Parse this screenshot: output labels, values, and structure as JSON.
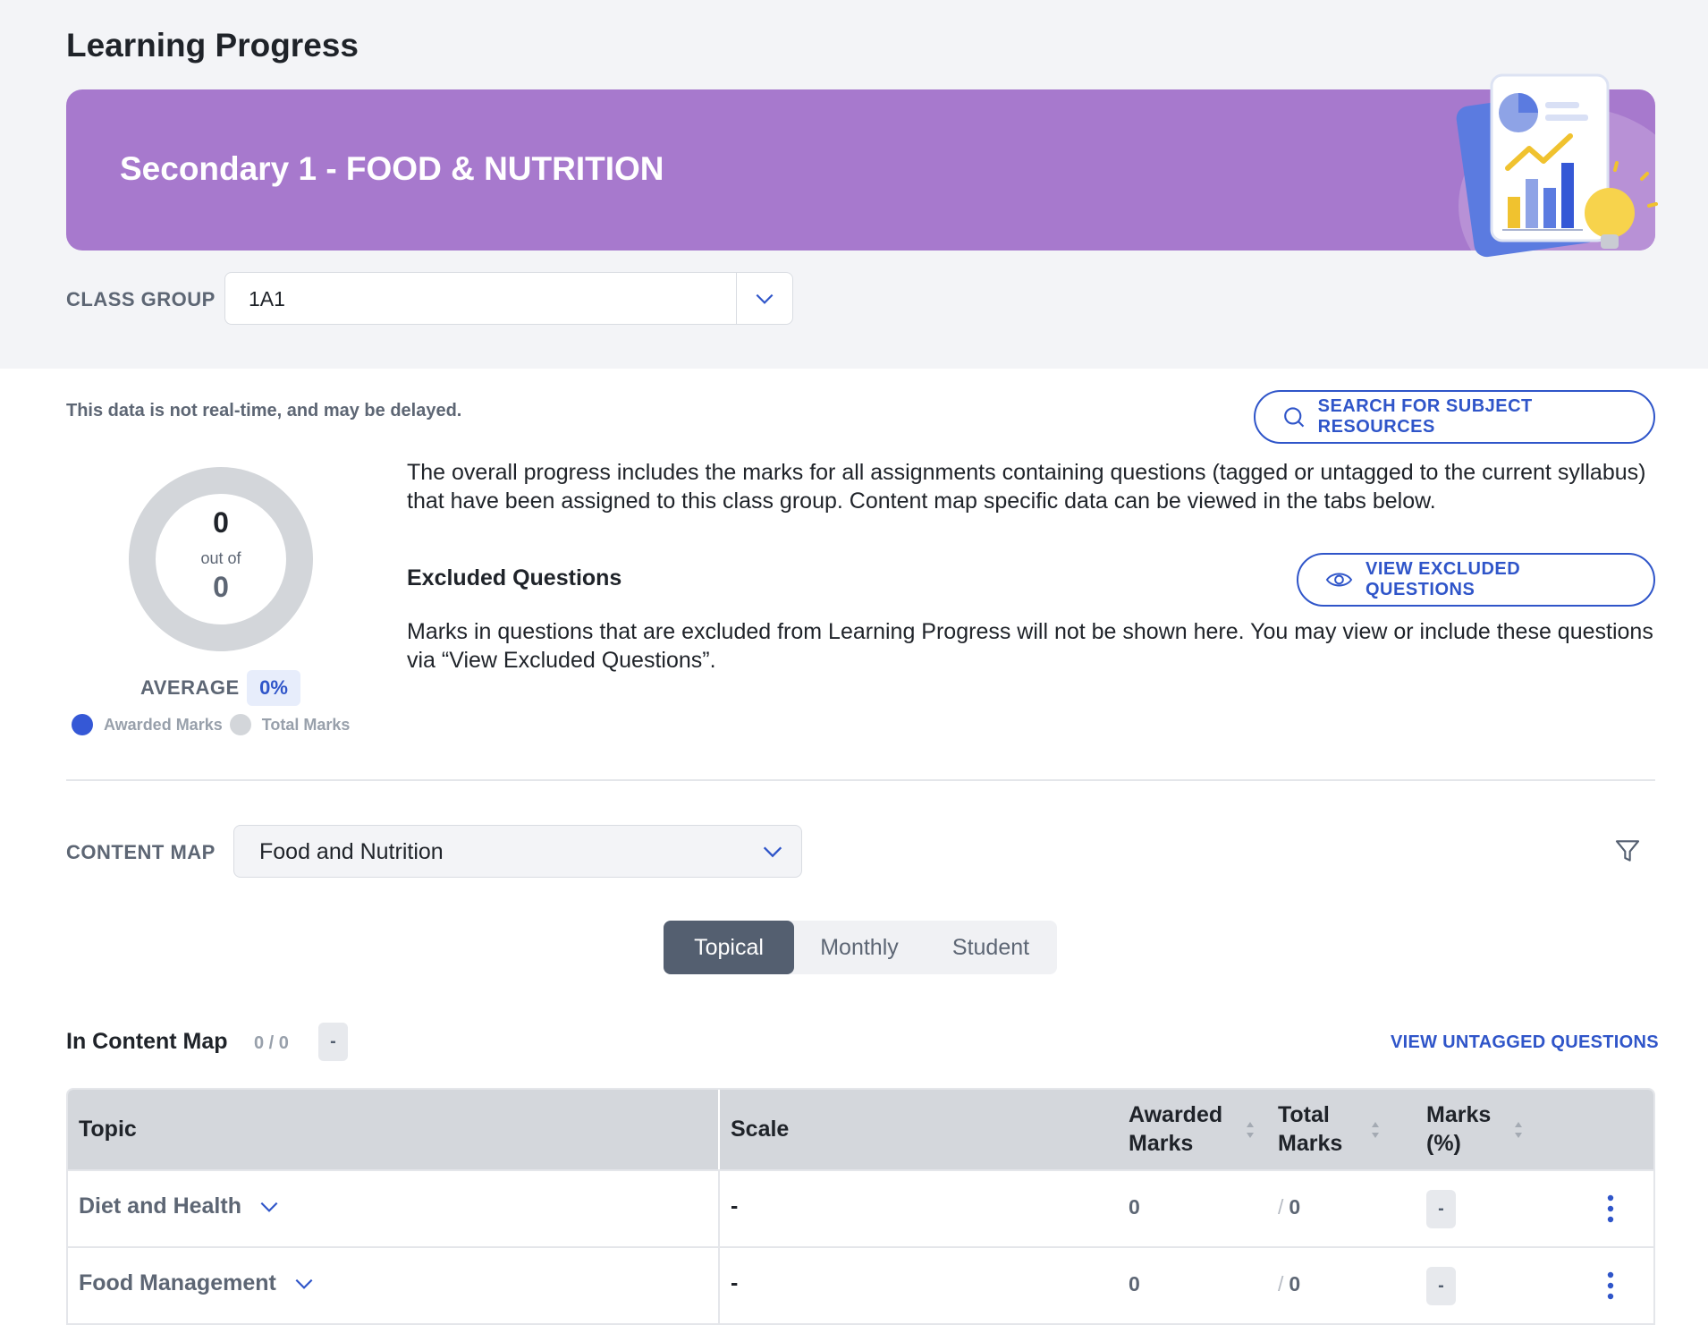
{
  "page": {
    "title": "Learning Progress"
  },
  "banner": {
    "title": "Secondary 1 - FOOD & NUTRITION"
  },
  "class_group": {
    "label": "CLASS GROUP",
    "value": "1A1"
  },
  "notice": "This data is not real-time, and may be delayed.",
  "search_button": {
    "label": "SEARCH FOR SUBJECT RESOURCES",
    "icon": "search-icon"
  },
  "overall": {
    "awarded": "0",
    "out_of_label": "out of",
    "total": "0",
    "average_label": "AVERAGE",
    "average_value": "0%",
    "legend": [
      {
        "label": "Awarded Marks",
        "color": "#3558d6"
      },
      {
        "label": "Total Marks",
        "color": "#d3d6da"
      }
    ],
    "description": "The overall progress includes the marks for all assignments containing questions (tagged or untagged to the current syllabus) that have been assigned to this class group. Content map specific data can be viewed in the tabs below."
  },
  "excluded": {
    "title": "Excluded Questions",
    "button_label": "VIEW EXCLUDED QUESTIONS",
    "button_icon": "eye-icon",
    "description": "Marks in questions that are excluded from Learning Progress will not be shown here. You may view or include these questions via “View Excluded Questions”."
  },
  "content_map": {
    "label": "CONTENT MAP",
    "value": "Food and Nutrition"
  },
  "tabs": [
    {
      "label": "Topical",
      "active": true
    },
    {
      "label": "Monthly",
      "active": false
    },
    {
      "label": "Student",
      "active": false
    }
  ],
  "in_content_map": {
    "title": "In Content Map",
    "count": "0 / 0",
    "badge": "-",
    "untagged_link": "VIEW UNTAGGED QUESTIONS"
  },
  "table": {
    "headers": {
      "topic": "Topic",
      "scale": "Scale",
      "awarded_1": "Awarded",
      "awarded_2": "Marks",
      "total_1": "Total",
      "total_2": "Marks",
      "pct_1": "Marks",
      "pct_2": "(%)"
    },
    "rows": [
      {
        "topic": "Diet and Health",
        "scale": "-",
        "awarded": "0",
        "total_sep": "/",
        "total": "0",
        "pct": "-"
      },
      {
        "topic": "Food Management",
        "scale": "-",
        "awarded": "0",
        "total_sep": "/",
        "total": "0",
        "pct": "-"
      }
    ]
  },
  "colors": {
    "accent": "#2f55c9",
    "banner": "#a779cd",
    "tab_active": "#545f70"
  }
}
